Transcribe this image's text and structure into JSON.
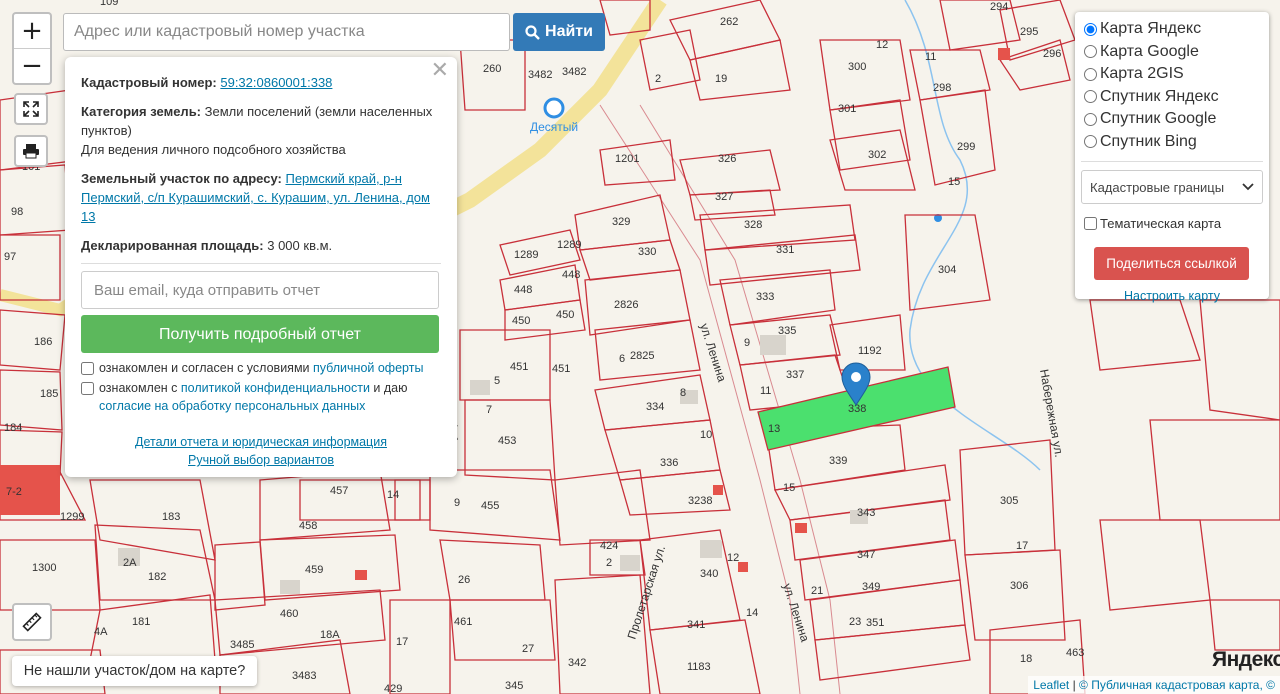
{
  "search": {
    "placeholder": "Адрес или кадастровый номер участка",
    "button_label": "Найти"
  },
  "zoom": {
    "in_label": "+",
    "out_label": "−"
  },
  "popup": {
    "cadastral_label": "Кадастровый номер:",
    "cadastral_value": "59:32:0860001:338",
    "category_label": "Категория земель:",
    "category_value": "Земли поселений (земли населенных пунктов)",
    "purpose": "Для ведения личного подсобного хозяйства",
    "address_label": "Земельный участок по адресу:",
    "address_value": "Пермский край, р-н Пермский, с/п Курашимский, с. Курашим, ул. Ленина, дом 13",
    "area_label": "Декларированная площадь:",
    "area_value": "3 000 кв.м.",
    "email_placeholder": "Ваш email, куда отправить отчет",
    "report_button": "Получить подробный отчет",
    "check1_text": "ознакомлен и согласен с условиями ",
    "check1_link": "публичной оферты",
    "check2_text_a": "ознакомлен с ",
    "check2_link_a": "политикой конфиденциальности",
    "check2_text_b": " и даю ",
    "check2_link_b": "согласие на обработку персональных данных",
    "details_link": "Детали отчета и юридическая информация",
    "manual_link": "Ручной выбор вариантов"
  },
  "layers": {
    "options": [
      "Карта Яндекс",
      "Карта Google",
      "Карта 2GIS",
      "Спутник Яндекс",
      "Спутник Google",
      "Спутник Bing"
    ],
    "selected": 0,
    "select_value": "Кадастровые границы",
    "thematic_label": "Тематическая карта",
    "share_button": "Поделиться ссылкой",
    "tune_link": "Настроить карту"
  },
  "not_found_button": "Не нашли участок/дом на карте?",
  "attribution": {
    "leaflet": "Leaflet",
    "source": "© Публичная кадастровая карта, ©"
  },
  "map": {
    "logo": "Яндекс",
    "place_label": "Десятый",
    "street_labels": [
      "ул. Ленина",
      "ул. Ленина",
      "Набережная ул.",
      "Пролетарская ул.",
      "ул."
    ],
    "parcel_labels": [
      "109",
      "262",
      "294",
      "295",
      "296",
      "12",
      "11",
      "300",
      "298",
      "260",
      "3482",
      "3482",
      "19",
      "2",
      "301",
      "302",
      "299",
      "1201",
      "326",
      "15",
      "327",
      "328",
      "101",
      "329",
      "330",
      "331",
      "98",
      "1289",
      "1289",
      "304",
      "448",
      "448",
      "97",
      "2826",
      "333",
      "450",
      "450",
      "335",
      "1192",
      "186",
      "9",
      "2825",
      "451",
      "451",
      "6",
      "337",
      "13",
      "338",
      "185",
      "11",
      "5",
      "334",
      "8",
      "7",
      "184",
      "453",
      "10",
      "336",
      "339",
      "7-2",
      "1299",
      "457",
      "14",
      "3238",
      "15",
      "305",
      "183",
      "458",
      "455",
      "9",
      "2A",
      "459",
      "343",
      "424",
      "2",
      "1300",
      "182",
      "26",
      "347",
      "340",
      "12",
      "17",
      "306",
      "460",
      "461",
      "341",
      "14",
      "349",
      "23",
      "351",
      "181",
      "4A",
      "3485",
      "18A",
      "21",
      "3483",
      "17",
      "27",
      "342",
      "1183",
      "18",
      "463",
      "429",
      "345"
    ]
  },
  "colors": {
    "parcel_line": "#c8303a",
    "selected_fill": "#4be06e",
    "road": "#f3e39a",
    "water": "#2f8ee3",
    "find_button": "#337ab7",
    "report_button": "#5cb85c",
    "share_button": "#d9534f"
  },
  "icons": {
    "zoom_in": "plus-icon",
    "zoom_out": "minus-icon",
    "fullscreen": "expand-icon",
    "print": "printer-icon",
    "ruler": "ruler-icon",
    "search": "search-icon",
    "marker": "map-marker-icon",
    "metro": "station-icon",
    "close": "close-icon",
    "dropdown": "chevron-down-icon"
  }
}
